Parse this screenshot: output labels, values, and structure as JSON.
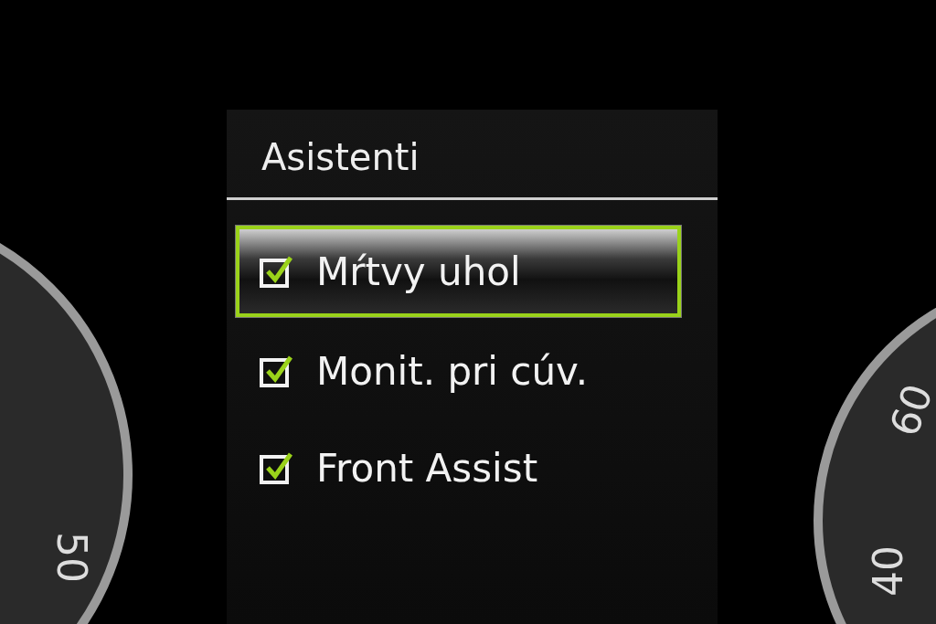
{
  "menu": {
    "title": "Asistenti",
    "items": [
      {
        "label": "Mŕtvy uhol",
        "checked": true,
        "selected": true
      },
      {
        "label": "Monit. pri cúv.",
        "checked": true,
        "selected": false
      },
      {
        "label": "Front Assist",
        "checked": true,
        "selected": false
      }
    ]
  },
  "gauges": [
    {
      "labels": [
        "50"
      ]
    },
    {
      "labels": [
        "60",
        "40"
      ]
    }
  ]
}
